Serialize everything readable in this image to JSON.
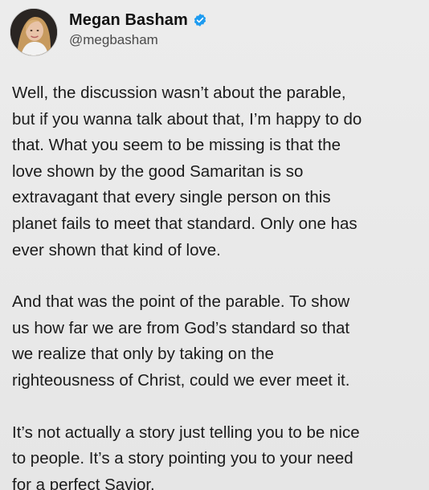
{
  "author": {
    "display_name": "Megan Basham",
    "handle": "@megbasham",
    "verified": true,
    "avatar_icon": "profile-photo"
  },
  "tweet": {
    "paragraphs": [
      "Well, the discussion wasn’t about the parable,\nbut if you wanna talk about that, I’m happy to do\nthat. What you seem to be missing is that the\nlove shown by the good Samaritan is so\nextravagant that every single person on this\nplanet fails to meet that standard. Only one has\never shown that kind of love.",
      "And that was the point of the parable. To show\nus how far we are from God’s standard so that\nwe realize that only by taking on the\nrighteousness of Christ, could we ever meet it.",
      "It’s not actually a story just telling you to be nice\nto people. It’s a story pointing you to your need\nfor a perfect Savior."
    ]
  },
  "colors": {
    "background": "#e9e9e9",
    "text": "#1b1b1b",
    "handle": "#4a4a4a",
    "verified_badge": "#1d9bf0"
  }
}
